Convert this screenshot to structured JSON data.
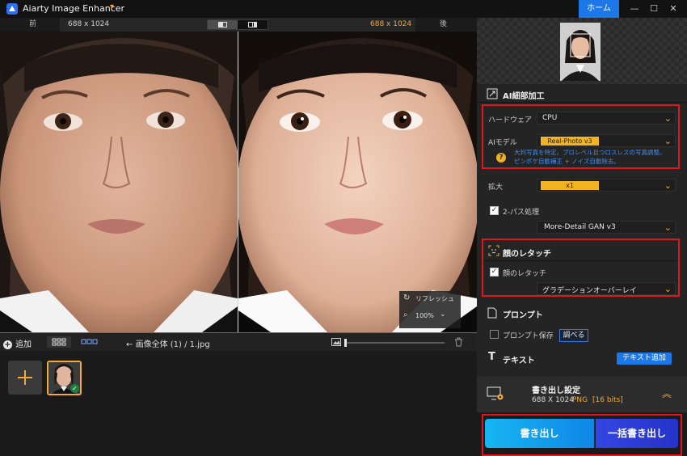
{
  "titlebar": {
    "app_title": "Aiarty Image Enhancer",
    "home_label": "ホーム",
    "minimize_glyph": "—",
    "maximize_glyph": "☐",
    "close_glyph": "✕"
  },
  "compare": {
    "before_label": "前",
    "after_label": "後",
    "left_dimensions": "688 x 1024",
    "right_dimensions": "688 x 1024"
  },
  "preview": {
    "refresh_label": "リフレッシュ",
    "zoom_value": "100%"
  },
  "toolbar": {
    "add_label": "追加",
    "breadcrumb_root": "画像全体 (1)",
    "breadcrumb_sep": "/",
    "breadcrumb_file": "1.jpg"
  },
  "panel": {
    "ai_section_title": "AI細部加工",
    "hardware_label": "ハードウェア",
    "hardware_value": "CPU",
    "ai_model_label": "AIモデル",
    "ai_model_value": "Real-Photo  v3",
    "ai_model_help_line1": "大判写真を特定。プロレベル且つロスレスの写真調整。",
    "ai_model_help_line2": "ピンボケ自動補正 + ノイズ自動除去。",
    "scale_label": "拡大",
    "scale_value": "x1",
    "two_pass_label": "2-パス処理",
    "two_pass_checked": true,
    "two_pass_model": "More-Detail GAN  v3",
    "face_section_title": "顔のレタッチ",
    "face_retouch_label": "顔のレタッチ",
    "face_retouch_checked": true,
    "face_retouch_mode": "グラデーションオーバーレイ",
    "prompt_section_title": "プロンプト",
    "prompt_save_label": "プロンプト保存",
    "prompt_save_checked": false,
    "prompt_browse_label": "調べる",
    "text_section_title": "テキスト",
    "text_add_label": "テキスト追加",
    "export_settings_title": "書き出し設定",
    "export_dimensions": "688 X 1024",
    "export_format": "PNG",
    "export_bits": "[16 bits]",
    "export_label": "書き出し",
    "batch_export_label": "一括書き出し"
  },
  "colors": {
    "accent": "#f2a93a",
    "highlight_red": "#e0161c",
    "home_blue": "#1c78e6",
    "export_cyan": "#12a8f0",
    "batch_export_blue": "#2a3fd6"
  }
}
